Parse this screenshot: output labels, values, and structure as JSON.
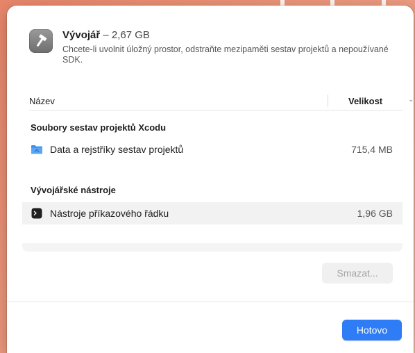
{
  "header": {
    "name": "Vývojář",
    "separator": " – ",
    "size": "2,67 GB",
    "description": "Chcete-li uvolnit úložný prostor, odstraňte mezipaměti sestav projektů a nepoužívané SDK.",
    "icon": "hammer-icon"
  },
  "columns": {
    "name": "Název",
    "size": "Velikost"
  },
  "sections": [
    {
      "title": "Soubory sestav projektů Xcodu",
      "items": [
        {
          "label": "Data a rejstříky sestav projektů",
          "size": "715,4 MB",
          "icon": "folder-icon"
        }
      ]
    },
    {
      "title": "Vývojářské nástroje",
      "items": [
        {
          "label": "Nástroje příkazového řádku",
          "size": "1,96 GB",
          "icon": "terminal-icon"
        }
      ]
    }
  ],
  "buttons": {
    "delete": "Smazat...",
    "done": "Hotovo"
  },
  "colors": {
    "accent": "#2f7df6",
    "folder": "#3b8ef0"
  }
}
